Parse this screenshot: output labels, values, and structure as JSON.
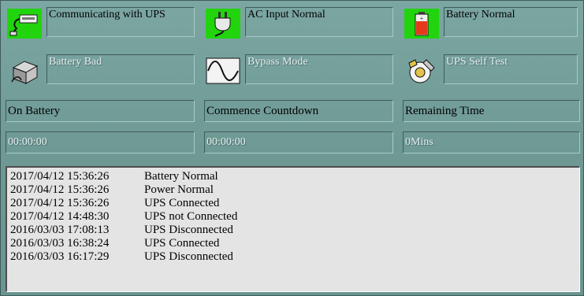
{
  "status_indicators": [
    {
      "label": "Communicating with UPS",
      "active": true,
      "icon": "communication-cable-icon"
    },
    {
      "label": "AC Input Normal",
      "active": true,
      "icon": "ac-plug-icon"
    },
    {
      "label": "Battery Normal",
      "active": true,
      "icon": "battery-icon"
    },
    {
      "label": "Battery Bad",
      "active": false,
      "icon": "bad-battery-box-icon"
    },
    {
      "label": "Bypass Mode",
      "active": false,
      "icon": "sine-wave-icon"
    },
    {
      "label": "UPS Self Test",
      "active": false,
      "icon": "self-test-tools-icon"
    }
  ],
  "fields": {
    "on_battery": {
      "label": "On Battery",
      "value": "00:00:00"
    },
    "commence_countdown": {
      "label": "Commence Countdown",
      "value": "00:00:00"
    },
    "remaining_time": {
      "label": "Remaining Time",
      "value": "0Mins"
    }
  },
  "event_log": [
    {
      "time": "2017/04/12 15:36:26",
      "event": "Battery Normal"
    },
    {
      "time": "2017/04/12 15:36:26",
      "event": "Power Normal"
    },
    {
      "time": "2017/04/12 15:36:26",
      "event": "UPS Connected"
    },
    {
      "time": "2017/04/12 14:48:30",
      "event": "UPS not Connected"
    },
    {
      "time": "2016/03/03 17:08:13",
      "event": "UPS Disconnected"
    },
    {
      "time": "2016/03/03 16:38:24",
      "event": "UPS Connected"
    },
    {
      "time": "2016/03/03 16:17:29",
      "event": "UPS Disconnected"
    }
  ],
  "colors": {
    "panel_bg": "#6f9a96",
    "active_indicator": "#22d40e",
    "log_bg": "#e4e4e4"
  }
}
